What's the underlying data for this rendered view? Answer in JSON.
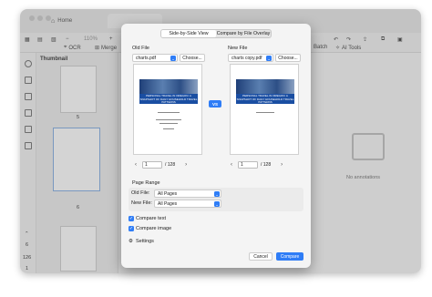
{
  "window": {
    "tabs": [
      {
        "label": "Home"
      }
    ],
    "zoom": "110%"
  },
  "toolbar": {
    "ocr_label": "OCR",
    "merge_label": "Merge",
    "batch_label": "Batch",
    "ai_tools_label": "AI Tools"
  },
  "thumbnail_pane": {
    "title": "Thumbnail",
    "page_numbers": [
      "5",
      "6"
    ]
  },
  "sidebar": {
    "left_numbers": [
      "6",
      "126",
      "1"
    ]
  },
  "main": {
    "no_annotations": "No annotations"
  },
  "dialog": {
    "view_tabs": [
      "Side-by-Side View",
      "Compare by File Overlay"
    ],
    "old_file": {
      "label": "Old File",
      "filename": "charts.pdf",
      "choose_label": "Choose...",
      "page": "1",
      "total": "/ 128"
    },
    "new_file": {
      "label": "New File",
      "filename": "charts copy.pdf",
      "choose_label": "Choose...",
      "page": "1",
      "total": "/ 128"
    },
    "vs_label": "VS",
    "preview_title": "PERSONAL TRAVEL IN OREGON: A SNAPSHOT OF DAILY HOUSEHOLD TRAVEL PATTERNS",
    "page_range": {
      "title": "Page Range",
      "old_file_label": "Old File:",
      "old_file_value": "All Pages",
      "new_file_label": "New File:",
      "new_file_value": "All Pages"
    },
    "compare_text_label": "Compare text",
    "compare_image_label": "Compare image",
    "settings_label": "Settings",
    "cancel_label": "Cancel",
    "compare_label": "Compare"
  },
  "colors": {
    "accent": "#2f7df6"
  }
}
